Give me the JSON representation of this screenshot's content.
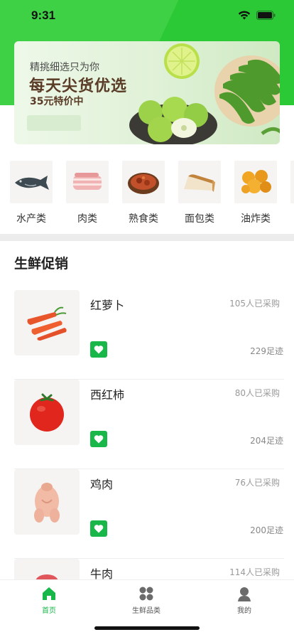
{
  "status": {
    "time": "9:31"
  },
  "banner": {
    "subtitle": "精挑细选只为你",
    "title": "每天尖货优选",
    "price": "35元特价中"
  },
  "categories": [
    {
      "label": "水产类",
      "icon": "fish-icon"
    },
    {
      "label": "肉类",
      "icon": "pork-icon"
    },
    {
      "label": "熟食类",
      "icon": "cooked-food-icon"
    },
    {
      "label": "面包类",
      "icon": "bread-icon"
    },
    {
      "label": "油炸类",
      "icon": "fried-food-icon"
    }
  ],
  "section": {
    "title": "生鲜促销"
  },
  "products": [
    {
      "name": "红萝卜",
      "buyers": "105人已采购",
      "footprints": "229足迹",
      "icon": "carrot-icon"
    },
    {
      "name": "西红柿",
      "buyers": "80人已采购",
      "footprints": "204足迹",
      "icon": "tomato-icon"
    },
    {
      "name": "鸡肉",
      "buyers": "76人已采购",
      "footprints": "200足迹",
      "icon": "chicken-icon"
    },
    {
      "name": "牛肉",
      "buyers": "114人已采购",
      "footprints": "",
      "icon": "beef-icon"
    }
  ],
  "tabbar": {
    "home": "首页",
    "fresh": "生鲜品类",
    "mine": "我的"
  },
  "colors": {
    "brand_green": "#19b64a",
    "header_green": "#3fd145"
  }
}
